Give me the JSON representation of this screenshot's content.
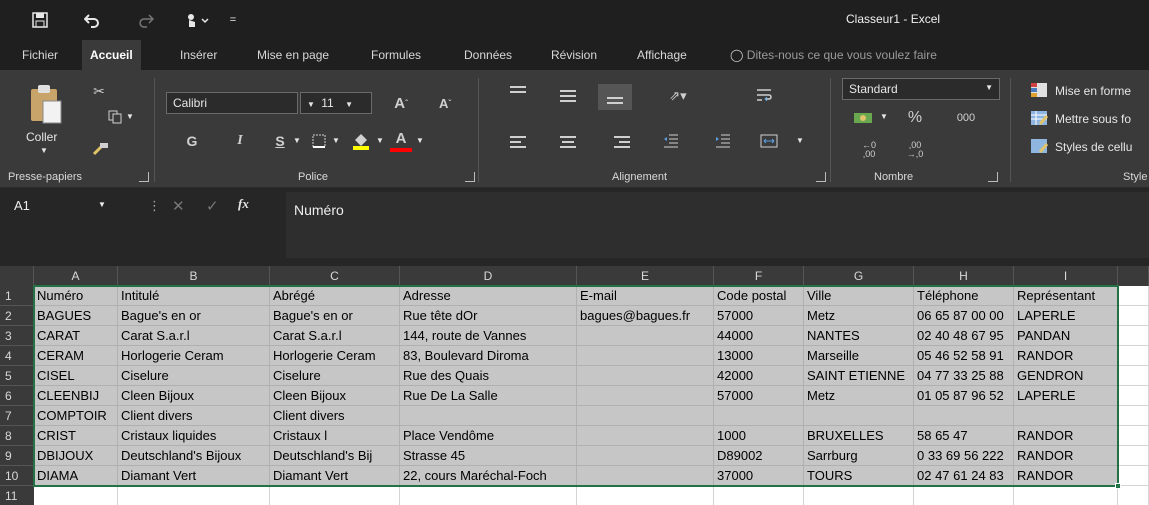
{
  "window": {
    "title": "Classeur1  -  Excel"
  },
  "tabs": [
    "Fichier",
    "Accueil",
    "Insérer",
    "Mise en page",
    "Formules",
    "Données",
    "Révision",
    "Affichage"
  ],
  "active_tab": "Accueil",
  "tell_me": "Dites-nous ce que vous voulez faire",
  "ribbon": {
    "clipboard": {
      "paste_label": "Coller",
      "group_label": "Presse-papiers"
    },
    "font": {
      "name": "Calibri",
      "size": "11",
      "bold": "G",
      "italic": "I",
      "underline": "S",
      "group_label": "Police"
    },
    "alignment": {
      "group_label": "Alignement"
    },
    "number": {
      "format": "Standard",
      "percent": "%",
      "thousands": "000",
      "group_label": "Nombre"
    },
    "styles": {
      "conditional": "Mise en forme",
      "table": "Mettre sous fo",
      "cell": "Styles de cellu",
      "group_label": "Style"
    }
  },
  "formula_bar": {
    "cell_ref": "A1",
    "fx": "fx",
    "value": "Numéro"
  },
  "columns": [
    "A",
    "B",
    "C",
    "D",
    "E",
    "F",
    "G",
    "H",
    "I"
  ],
  "rows": [
    [
      "Numéro",
      "Intitulé",
      "Abrégé",
      "Adresse",
      "E-mail",
      "Code postal",
      "Ville",
      "Téléphone",
      "Représentant"
    ],
    [
      "BAGUES",
      "Bague's en or",
      "Bague's en or",
      "Rue tête dOr",
      "bagues@bagues.fr",
      "57000",
      "Metz",
      "06 65 87 00 00",
      "LAPERLE"
    ],
    [
      "CARAT",
      "Carat S.a.r.l",
      "Carat S.a.r.l",
      "144, route de Vannes",
      "",
      "44000",
      "NANTES",
      "02 40 48 67 95",
      "PANDAN"
    ],
    [
      "CERAM",
      "Horlogerie Ceram",
      "Horlogerie Ceram",
      "83, Boulevard Diroma",
      "",
      "13000",
      "Marseille",
      "05 46 52 58 91",
      "RANDOR"
    ],
    [
      "CISEL",
      "Ciselure",
      "Ciselure",
      "Rue des Quais",
      "",
      "42000",
      "SAINT ETIENNE",
      "04 77 33 25 88",
      "GENDRON"
    ],
    [
      "CLEENBIJ",
      "Cleen Bijoux",
      "Cleen Bijoux",
      "Rue De La Salle",
      "",
      "57000",
      "Metz",
      "01 05 87 96 52",
      "LAPERLE"
    ],
    [
      "COMPTOIR",
      "Client divers",
      "Client divers",
      "",
      "",
      "",
      "",
      "",
      ""
    ],
    [
      "CRIST",
      "Cristaux liquides",
      "Cristaux l",
      "Place Vendôme",
      "",
      "1000",
      "BRUXELLES",
      "58 65 47",
      "RANDOR"
    ],
    [
      "DBIJOUX",
      "Deutschland's Bijoux",
      "Deutschland's Bij",
      "Strasse 45",
      "",
      "D89002",
      "Sarrburg",
      "0 33 69 56 222",
      "RANDOR"
    ],
    [
      "DIAMA",
      "Diamant Vert",
      "Diamant Vert",
      "22, cours Maréchal-Foch",
      "",
      "37000",
      "TOURS",
      "02 47 61 24 83",
      "RANDOR"
    ],
    [
      "",
      "",
      "",
      "",
      "",
      "",
      "",
      "",
      ""
    ],
    [
      "",
      "",
      "",
      "",
      "",
      "",
      "",
      "",
      ""
    ]
  ],
  "selected_range": "A1:I10"
}
